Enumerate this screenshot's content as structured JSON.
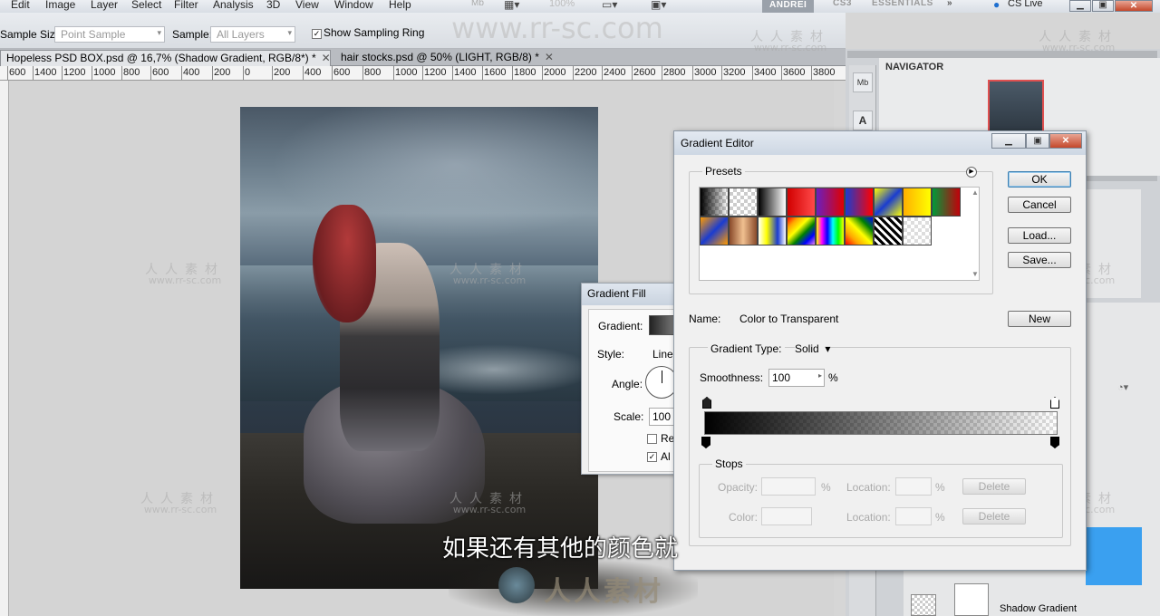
{
  "menu": [
    "Edit",
    "Image",
    "Layer",
    "Select",
    "Filter",
    "Analysis",
    "3D",
    "View",
    "Window",
    "Help"
  ],
  "menu_extra": [
    "Mb",
    "100%"
  ],
  "workspaces": {
    "active": "ANDREI",
    "cs3": "CS3",
    "essentials": "ESSENTIALS",
    "cslive": "CS Live"
  },
  "options": {
    "sample_size_label": "Sample Size:",
    "sample_size_value": "Point Sample",
    "sample_label": "Sample:",
    "sample_value": "All Layers",
    "show_ring_label": "Show Sampling Ring",
    "show_ring_checked": true
  },
  "tabs": [
    {
      "label": "Hopeless PSD BOX.psd @ 16,7% (Shadow Gradient, RGB/8*) *",
      "active": true
    },
    {
      "label": "hair stocks.psd @ 50% (LIGHT, RGB/8) *",
      "active": false
    }
  ],
  "ruler": [
    "600",
    "1400",
    "1200",
    "1000",
    "800",
    "600",
    "400",
    "200",
    "0",
    "200",
    "400",
    "600",
    "800",
    "1000",
    "1200",
    "1400",
    "1600",
    "1800",
    "2000",
    "2200",
    "2400",
    "2600",
    "2800",
    "3000",
    "3200",
    "3400",
    "3600",
    "3800"
  ],
  "watermark": {
    "cn": "人人素材",
    "url": "www.rr-sc.com",
    "big_url": "www.rr-sc.com"
  },
  "gradient_fill": {
    "title": "Gradient Fill",
    "gradient_label": "Gradient:",
    "style_label": "Style:",
    "style_value": "Line",
    "angle_label": "Angle:",
    "scale_label": "Scale:",
    "scale_value": "100",
    "reverse_label": "Re",
    "align_label": "Al"
  },
  "gradient_editor": {
    "title": "Gradient Editor",
    "presets_label": "Presets",
    "ok": "OK",
    "cancel": "Cancel",
    "load": "Load...",
    "save": "Save...",
    "new": "New",
    "name_label": "Name:",
    "name_value": "Color to Transparent",
    "type_label": "Gradient Type:",
    "type_value": "Solid",
    "smoothness_label": "Smoothness:",
    "smoothness_value": "100",
    "smoothness_unit": "%",
    "stops_label": "Stops",
    "opacity_label": "Opacity:",
    "color_label": "Color:",
    "location_label": "Location:",
    "pct": "%",
    "delete": "Delete",
    "presets": [
      "linear-gradient(90deg,#000,#fff)",
      "repeating-conic-gradient(#ccc 0 25%,#fff 0 50%)",
      "linear-gradient(90deg,#000,#fff)",
      "linear-gradient(90deg,#d10000,#ff4a4a)",
      "linear-gradient(90deg,#6a1fbf,#e00000)",
      "linear-gradient(90deg,#1a3cd0,#ff0000)",
      "linear-gradient(135deg,#ff0,#1a3cd0 50%,#ff0)",
      "linear-gradient(90deg,#ffb000,#ff0)",
      "linear-gradient(90deg,#009a3a,#c2000a)",
      "linear-gradient(135deg,#ff9a00,#1a3cd0 50%,#ff9a00)",
      "linear-gradient(90deg,#8a4a2a,#f0c090,#8a4a2a)",
      "linear-gradient(90deg,#fff,#ff0 30%,#1a3cd0 70%,#fff)",
      "linear-gradient(135deg,red,orange,yellow,green,blue,violet)",
      "linear-gradient(90deg,#ff0,#f0f,#00f,#0ff,#0f0,#ff0)",
      "linear-gradient(45deg,red,orange,yellow,green,blue)",
      "repeating-linear-gradient(45deg,#000 0 3px,#fff 3px 6px)",
      "repeating-conic-gradient(#ddd 0 25%,#fff 0 50%)"
    ]
  },
  "navigator": {
    "title": "NAVIGATOR"
  },
  "panel_bottom_label": "Shadow Gradient",
  "subtitle": "如果还有其他的颜色就",
  "logo_text": "人人素材",
  "colors": {
    "selection_blue": "#3aa0f0",
    "accent": "#d33"
  }
}
